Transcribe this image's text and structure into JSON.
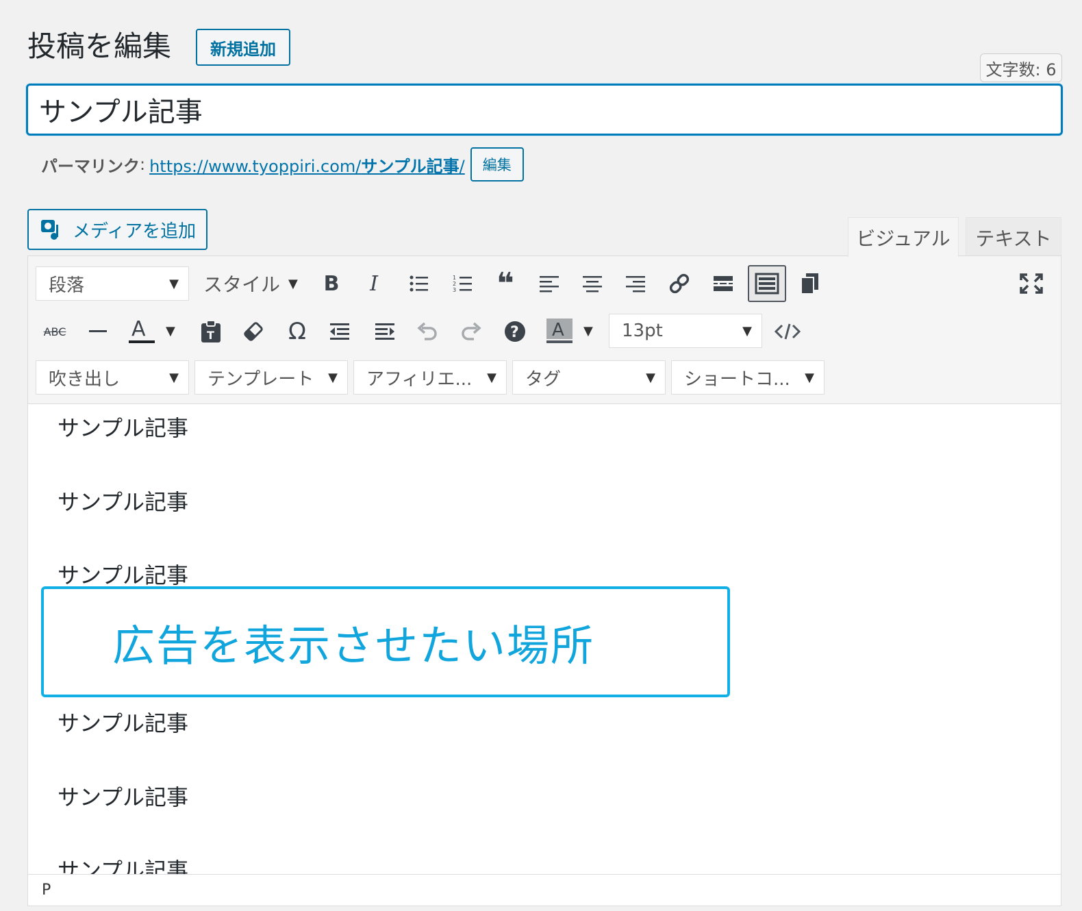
{
  "header": {
    "title": "投稿を編集",
    "add_new_label": "新規追加",
    "char_count": "文字数: 6"
  },
  "post": {
    "title": "サンプル記事"
  },
  "permalink": {
    "label": "パーマリンク",
    "separator": ":",
    "base_url": "https://www.tyoppiri.com/",
    "slug": "サンプル記事",
    "trailing_slash": "/",
    "edit_label": "編集"
  },
  "media": {
    "add_media_label": "メディアを追加"
  },
  "tabs": {
    "visual": "ビジュアル",
    "text": "テキスト"
  },
  "toolbar": {
    "format_select": "段落",
    "styles_label": "スタイル",
    "font_size": "13pt",
    "row3_selects": [
      "吹き出し",
      "テンプレート",
      "アフィリエ...",
      "タグ",
      "ショートコ..."
    ],
    "icons": {
      "row1": [
        "bold-icon",
        "italic-icon",
        "bullet-list-icon",
        "numbered-list-icon",
        "blockquote-icon",
        "align-left-icon",
        "align-center-icon",
        "align-right-icon",
        "link-icon",
        "read-more-icon",
        "toolbar-toggle-icon",
        "copy-icon",
        "fullscreen-icon"
      ],
      "row2": [
        "strikethrough-icon",
        "horizontal-line-icon",
        "text-color-icon",
        "paste-text-icon",
        "clear-formatting-icon",
        "special-character-icon",
        "outdent-icon",
        "indent-icon",
        "undo-icon",
        "redo-icon",
        "help-icon",
        "background-color-icon",
        "code-icon"
      ]
    }
  },
  "content": {
    "paragraphs_before": [
      "サンプル記事",
      "サンプル記事",
      "サンプル記事"
    ],
    "callout": "広告を表示させたい場所",
    "paragraphs_after": [
      "サンプル記事",
      "サンプル記事",
      "サンプル記事"
    ]
  },
  "statusbar": {
    "path": "P"
  },
  "colors": {
    "accent": "#0071a1",
    "focus_border": "#007cba",
    "callout": "#10b0e6"
  }
}
